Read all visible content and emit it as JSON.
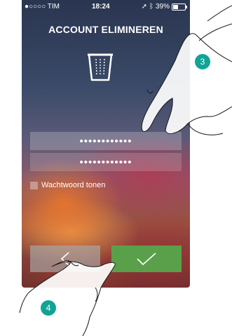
{
  "status_bar": {
    "carrier": "●○○○○ TIM",
    "time": "18:24",
    "battery": "39%"
  },
  "screen": {
    "title": "ACCOUNT ELIMINEREN",
    "password_field_1": "••••••••••••",
    "password_field_2": "••••••••••••",
    "show_password_label": "Wachtwoord tonen"
  },
  "callouts": {
    "step_3": "3",
    "step_4": "4"
  },
  "colors": {
    "confirm_button": "#5aa04a",
    "callout": "#10a496"
  }
}
